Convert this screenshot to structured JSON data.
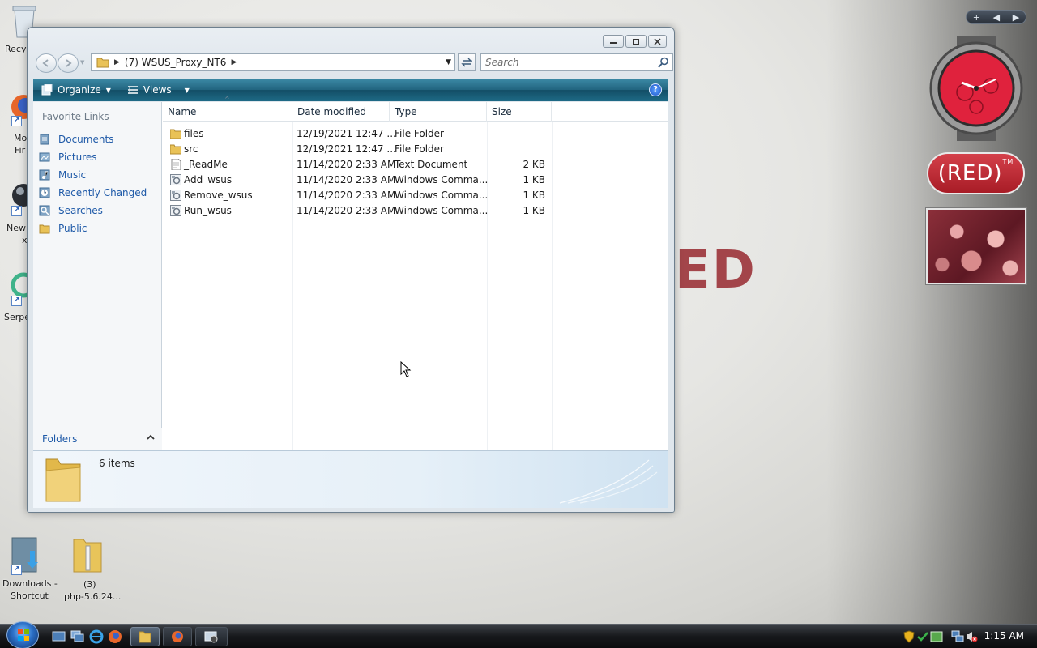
{
  "desktop": {
    "icons": [
      {
        "label": "Recy",
        "name": "recycle-bin-icon"
      },
      {
        "label": "Mo",
        "label2": "Fir",
        "name": "firefox-icon"
      },
      {
        "label": "New",
        "label2": "x",
        "name": "new-shortcut-icon"
      },
      {
        "label": "Serpe",
        "name": "serpe-shortcut-icon"
      },
      {
        "label": "Downloads -",
        "label2": "Shortcut",
        "name": "downloads-shortcut-icon"
      },
      {
        "label": "(3)",
        "label2": "php-5.6.24...",
        "name": "php-folder-icon"
      }
    ],
    "background_text": "ED"
  },
  "window": {
    "address": {
      "folder_icon": "folder-icon",
      "crumb": "(7) WSUS_Proxy_NT6"
    },
    "search": {
      "placeholder": "Search"
    },
    "toolbar": {
      "organize": "Organize",
      "views": "Views",
      "help": "?"
    },
    "nav_pane": {
      "header": "Favorite Links",
      "links": [
        "Documents",
        "Pictures",
        "Music",
        "Recently Changed",
        "Searches",
        "Public"
      ],
      "folders_label": "Folders"
    },
    "columns": {
      "name": "Name",
      "date": "Date modified",
      "type": "Type",
      "size": "Size"
    },
    "files": [
      {
        "name": "files",
        "date": "12/19/2021 12:47 ...",
        "type": "File Folder",
        "size": "",
        "icon": "folder-icon"
      },
      {
        "name": "src",
        "date": "12/19/2021 12:47 ...",
        "type": "File Folder",
        "size": "",
        "icon": "folder-icon"
      },
      {
        "name": "_ReadMe",
        "date": "11/14/2020 2:33 AM",
        "type": "Text Document",
        "size": "2 KB",
        "icon": "text-document-icon"
      },
      {
        "name": "Add_wsus",
        "date": "11/14/2020 2:33 AM",
        "type": "Windows Comma...",
        "size": "1 KB",
        "icon": "command-script-icon"
      },
      {
        "name": "Remove_wsus",
        "date": "11/14/2020 2:33 AM",
        "type": "Windows Comma...",
        "size": "1 KB",
        "icon": "command-script-icon"
      },
      {
        "name": "Run_wsus",
        "date": "11/14/2020 2:33 AM",
        "type": "Windows Comma...",
        "size": "1 KB",
        "icon": "command-script-icon"
      }
    ],
    "details": {
      "count": "6 items"
    }
  },
  "gadgets": {
    "bar_plus": "+",
    "red_badge": "(RED)",
    "red_tm": "TM"
  },
  "taskbar": {
    "clock": "1:15 AM"
  }
}
